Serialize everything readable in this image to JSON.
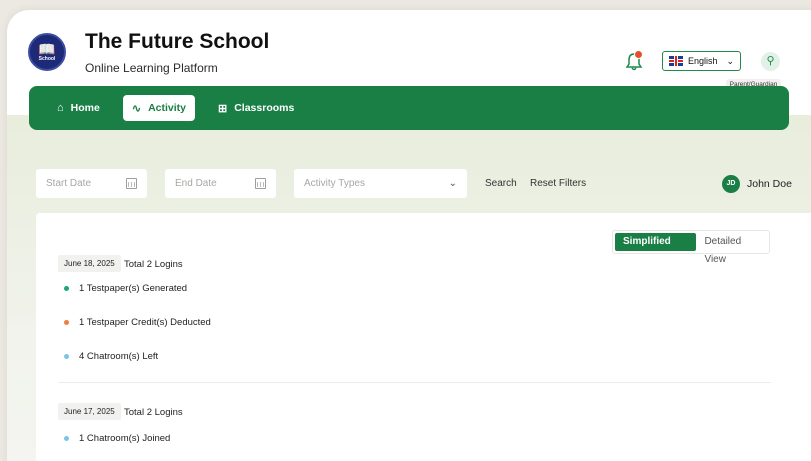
{
  "brand": {
    "title": "The Future School",
    "subtitle": "Online Learning Platform",
    "logo_text": "School"
  },
  "header": {
    "language": "English",
    "role": "Parent/Guardian",
    "notification_icon": "bell-icon",
    "user_icon": "user-icon"
  },
  "nav": {
    "items": [
      {
        "label": "Home",
        "icon": "home-icon",
        "active": false
      },
      {
        "label": "Activity",
        "icon": "activity-icon",
        "active": true
      },
      {
        "label": "Classrooms",
        "icon": "book-icon",
        "active": false
      }
    ]
  },
  "filters": {
    "start_date_placeholder": "Start Date",
    "end_date_placeholder": "End Date",
    "activity_types_placeholder": "Activity Types",
    "search_label": "Search",
    "reset_label": "Reset Filters"
  },
  "user": {
    "initials": "JD",
    "name": "John Doe"
  },
  "view_toggle": {
    "simplified": "Simplified View",
    "detailed": "Detailed View",
    "selected": "Simplified View"
  },
  "days": [
    {
      "date": "June 18, 2025",
      "total": "Total 2 Logins",
      "activities": [
        {
          "text": "1 Testpaper(s) Generated",
          "color": "#1aa57a"
        },
        {
          "text": "1 Testpaper Credit(s) Deducted",
          "color": "#f07d3c"
        },
        {
          "text": "4 Chatroom(s) Left",
          "color": "#7dc3e8"
        }
      ]
    },
    {
      "date": "June 17, 2025",
      "total": "Total 2 Logins",
      "activities": [
        {
          "text": "1 Chatroom(s) Joined",
          "color": "#7dc3e8"
        }
      ]
    }
  ],
  "colors": {
    "brand_green": "#1a7f45",
    "logo_navy": "#1d2a78"
  }
}
